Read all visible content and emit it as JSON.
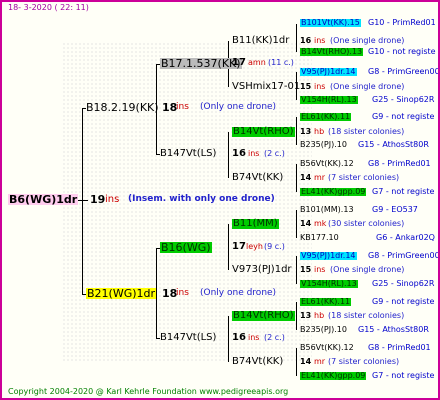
{
  "date": "18-  3-2020 (  22: 11)",
  "copyright": "Copyright 2004-2020 @ Karl Kehrle Foundation    www.pedigreeapis.org",
  "root": {
    "name": "B6(WG)1dr",
    "num": "19",
    "ins": "ins",
    "note": "(Insem. with only one drone)"
  },
  "g1": [
    {
      "name": "B18.2.19(KK)",
      "num": "18",
      "ins": "ins",
      "note": "(Only one drone)"
    },
    {
      "name": "B21(WG)1dr",
      "num": "18",
      "ins": "ins",
      "note": "(Only one drone)"
    }
  ],
  "g2": [
    {
      "name": "B17.1.537(KK)",
      "num": "17",
      "ins": "amn",
      "note": "(11 c.)"
    },
    {
      "name": "B147Vt(LS)",
      "num": "16",
      "ins": "ins",
      "note": "(2 c.)"
    },
    {
      "name": "B16(WG)",
      "num": "17",
      "ins": "leyh",
      "note": "(9 c.)"
    },
    {
      "name": "B147Vt(LS)",
      "num": "16",
      "ins": "ins",
      "note": "(2 c.)"
    }
  ],
  "g3": [
    {
      "name": "B11(KK)1dr",
      "num": "16",
      "ins": "ins",
      "note": "(One single drone)"
    },
    {
      "name": "VSHmix17-01",
      "num": "15",
      "ins": "ins",
      "note": "(One single drone)"
    },
    {
      "name": "B14Vt(RHO)",
      "num": "13",
      "ins": "hb",
      "note": "(18 sister colonies)"
    },
    {
      "name": "B74Vt(KK)",
      "num": "14",
      "ins": "mr",
      "note": "(7 sister colonies)"
    },
    {
      "name": "B11(MM)",
      "num": "14",
      "ins": "mk",
      "note": "(30 sister colonies)"
    },
    {
      "name": "V973(PJ)1dr",
      "num": "15",
      "ins": "ins",
      "note": "(One single drone)"
    },
    {
      "name": "B14Vt(RHO)",
      "num": "13",
      "ins": "hb",
      "note": "(18 sister colonies)"
    },
    {
      "name": "B74Vt(KK)",
      "num": "14",
      "ins": "mr",
      "note": "(7 sister colonies)"
    }
  ],
  "g4": [
    {
      "name": "B101Vt(KK).15",
      "tag": "G10 - PrimRed01"
    },
    {
      "name": "B14Vt(RHO).13",
      "tag": "G10 - not registe"
    },
    {
      "name": "V95(PJ)1dr.14",
      "tag": "G8 - PrimGreen00"
    },
    {
      "name": "V154H(RL).13",
      "tag": "G25 - Sinop62R"
    },
    {
      "name": "EL61(KK).11",
      "tag": "G9 - not registe"
    },
    {
      "name": "B235(PJ).10",
      "tag": "G15 - AthosSt80R"
    },
    {
      "name": "B56Vt(KK).12",
      "tag": "G8 - PrimRed01"
    },
    {
      "name": "EL41(KK)gpp.09",
      "tag": "G7 - not registe"
    },
    {
      "name": "B101(MM).13",
      "tag": "G9 - EO537"
    },
    {
      "name": "KB177.10",
      "tag": "G6 - Ankar02Q"
    },
    {
      "name": "V95(PJ)1dr.14",
      "tag": "G8 - PrimGreen00"
    },
    {
      "name": "V154H(RL).13",
      "tag": "G25 - Sinop62R"
    },
    {
      "name": "EL61(KK).11",
      "tag": "G9 - not registe"
    },
    {
      "name": "B235(PJ).10",
      "tag": "G15 - AthosSt80R"
    },
    {
      "name": "B56Vt(KK).12",
      "tag": "G8 - PrimRed01"
    },
    {
      "name": "EL41(KK)gpp.09",
      "tag": "G7 - not registe"
    }
  ]
}
